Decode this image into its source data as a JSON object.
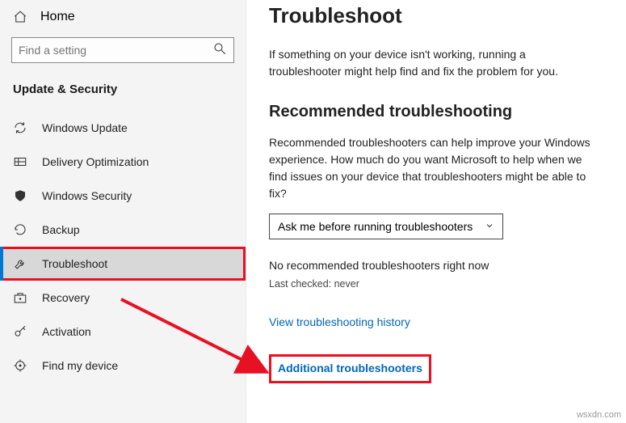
{
  "sidebar": {
    "home_label": "Home",
    "search_placeholder": "Find a setting",
    "category_label": "Update & Security",
    "items": [
      {
        "label": "Windows Update"
      },
      {
        "label": "Delivery Optimization"
      },
      {
        "label": "Windows Security"
      },
      {
        "label": "Backup"
      },
      {
        "label": "Troubleshoot"
      },
      {
        "label": "Recovery"
      },
      {
        "label": "Activation"
      },
      {
        "label": "Find my device"
      }
    ]
  },
  "main": {
    "title": "Troubleshoot",
    "intro": "If something on your device isn't working, running a troubleshooter might help find and fix the problem for you.",
    "recommended_heading": "Recommended troubleshooting",
    "recommended_desc": "Recommended troubleshooters can help improve your Windows experience. How much do you want Microsoft to help when we find issues on your device that troubleshooters might be able to fix?",
    "dropdown_value": "Ask me before running troubleshooters",
    "status_text": "No recommended troubleshooters right now",
    "last_checked": "Last checked: never",
    "history_link": "View troubleshooting history",
    "additional_link": "Additional troubleshooters"
  },
  "watermark": "wsxdn.com"
}
